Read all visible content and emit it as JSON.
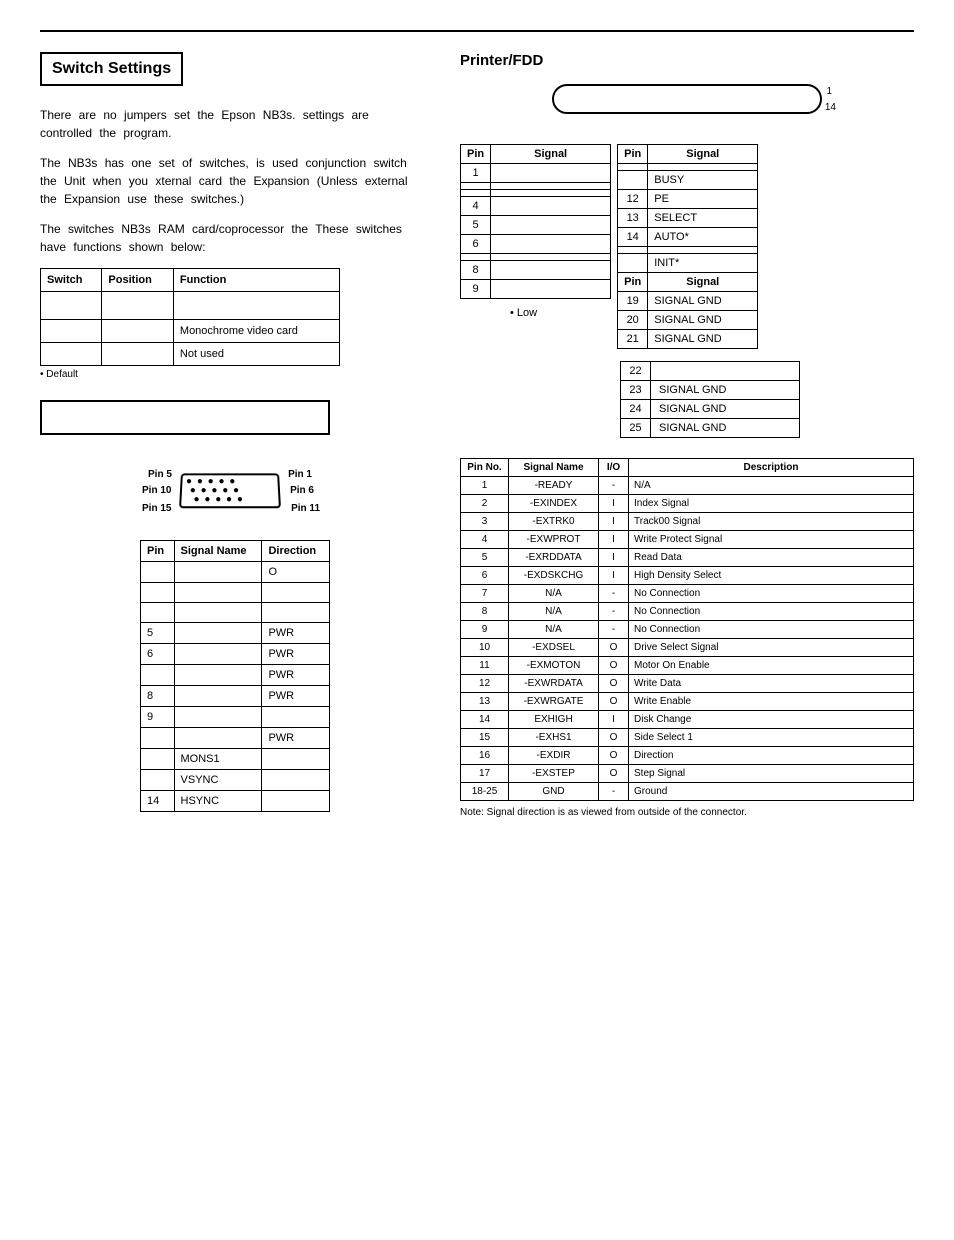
{
  "switch": {
    "title": "Switch Settings",
    "p1": "There are no jumpers set the Epson NB3s. settings are controlled the program.",
    "p2": "The NB3s has one set of switches, is used conjunction switch the Unit when you xternal card the Expansion (Unless external the Expansion use these switches.)",
    "p3": "The switches NB3s RAM card/coprocessor the These switches have functions shown below:",
    "cols": [
      "Switch",
      "Position",
      "Function"
    ],
    "rows": [
      [
        "",
        "",
        ""
      ],
      [
        "",
        "",
        "Monochrome video card"
      ],
      [
        "",
        "",
        "Not used"
      ]
    ],
    "note": "• Default"
  },
  "vga": {
    "pins": {
      "p1": "Pin 1",
      "p5": "Pin 5",
      "p6": "Pin 6",
      "p10": "Pin 10",
      "p11": "Pin 11",
      "p15": "Pin 15"
    },
    "cols": [
      "Pin",
      "Signal Name",
      "Direction"
    ],
    "rows": [
      [
        "",
        "",
        "O"
      ],
      [
        "",
        "",
        ""
      ],
      [
        "",
        "",
        ""
      ],
      [
        "5",
        "",
        "PWR"
      ],
      [
        "6",
        "",
        "PWR"
      ],
      [
        "",
        "",
        "PWR"
      ],
      [
        "8",
        "",
        "PWR"
      ],
      [
        "9",
        "",
        ""
      ],
      [
        "",
        "",
        "PWR"
      ],
      [
        "",
        "MONS1",
        ""
      ],
      [
        "",
        "VSYNC",
        ""
      ],
      [
        "14",
        "HSYNC",
        ""
      ]
    ]
  },
  "printer": {
    "title": "Printer/FDD",
    "conn": {
      "n1": "1",
      "n14": "14"
    },
    "left": {
      "cols": [
        "Pin",
        "Signal"
      ],
      "rows": [
        [
          "1",
          ""
        ],
        [
          "",
          ""
        ],
        [
          "",
          ""
        ],
        [
          "4",
          ""
        ],
        [
          "5",
          ""
        ],
        [
          "6",
          ""
        ],
        [
          "",
          ""
        ],
        [
          "8",
          ""
        ],
        [
          "9",
          ""
        ]
      ]
    },
    "right": {
      "cols": [
        "Pin",
        "Signal"
      ],
      "rows1": [
        [
          "",
          ""
        ],
        [
          "",
          "BUSY"
        ],
        [
          "12",
          "PE"
        ],
        [
          "13",
          "SELECT"
        ],
        [
          "14",
          "AUTO*"
        ],
        [
          "",
          ""
        ],
        [
          "",
          "INIT*"
        ]
      ],
      "cols2": [
        "Pin",
        "Signal"
      ],
      "rows2": [
        [
          "19",
          "SIGNAL GND"
        ],
        [
          "20",
          "SIGNAL GND"
        ],
        [
          "21",
          "SIGNAL GND"
        ]
      ]
    },
    "low_note": "• Low",
    "extra": [
      [
        "22",
        ""
      ],
      [
        "23",
        "SIGNAL GND"
      ],
      [
        "24",
        "SIGNAL GND"
      ],
      [
        "25",
        "SIGNAL GND"
      ]
    ]
  },
  "fdd": {
    "cols": [
      "Pin No.",
      "Signal Name",
      "I/O",
      "Description"
    ],
    "rows": [
      [
        "1",
        "-READY",
        "-",
        "N/A"
      ],
      [
        "2",
        "-EXINDEX",
        "I",
        "Index Signal"
      ],
      [
        "3",
        "-EXTRK0",
        "I",
        "Track00 Signal"
      ],
      [
        "4",
        "-EXWPROT",
        "I",
        "Write Protect Signal"
      ],
      [
        "5",
        "-EXRDDATA",
        "I",
        "Read Data"
      ],
      [
        "6",
        "-EXDSKCHG",
        "I",
        "High Density Select"
      ],
      [
        "7",
        "N/A",
        "-",
        "No Connection"
      ],
      [
        "8",
        "N/A",
        "-",
        "No Connection"
      ],
      [
        "9",
        "N/A",
        "-",
        "No Connection"
      ],
      [
        "10",
        "-EXDSEL",
        "O",
        "Drive Select Signal"
      ],
      [
        "11",
        "-EXMOTON",
        "O",
        "Motor On Enable"
      ],
      [
        "12",
        "-EXWRDATA",
        "O",
        "Write Data"
      ],
      [
        "13",
        "-EXWRGATE",
        "O",
        "Write Enable"
      ],
      [
        "14",
        "EXHIGH",
        "I",
        "Disk Change"
      ],
      [
        "15",
        "-EXHS1",
        "O",
        "Side Select 1"
      ],
      [
        "16",
        "-EXDIR",
        "O",
        "Direction"
      ],
      [
        "17",
        "-EXSTEP",
        "O",
        "Step Signal"
      ],
      [
        "18-25",
        "GND",
        "-",
        "Ground"
      ]
    ],
    "note": "Note: Signal direction is as viewed from outside of the connector."
  }
}
